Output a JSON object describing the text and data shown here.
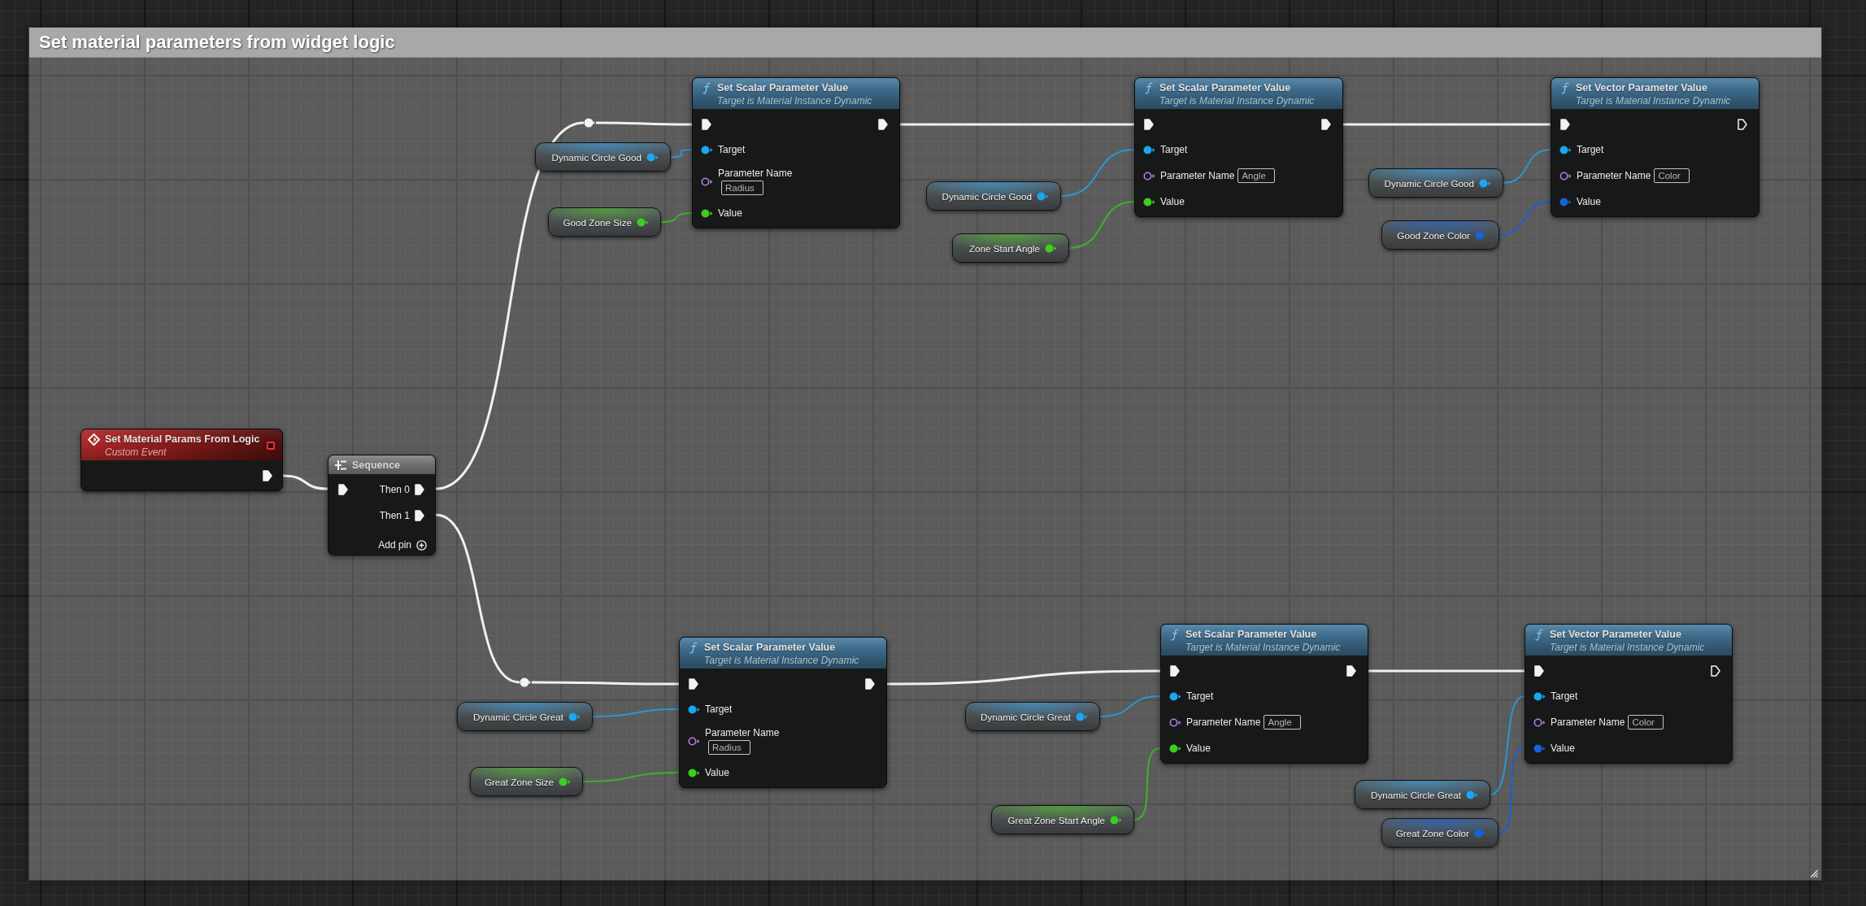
{
  "comment": {
    "title": "Set material parameters from widget logic"
  },
  "nodes": [
    {
      "kind": "event",
      "title": "Set Material Params From Logic",
      "subtitle": "Custom Event",
      "delegate": {
        "connected": false
      },
      "exec_out": {
        "connected": true
      }
    },
    {
      "kind": "sequence",
      "title": "Sequence",
      "exec_in": {
        "connected": true
      },
      "outputs": [
        {
          "label": "Then 0",
          "connected": true
        },
        {
          "label": "Then 1",
          "connected": true
        }
      ],
      "add_pin": "Add pin"
    },
    {
      "kind": "reroute"
    },
    {
      "kind": "variable",
      "name": "Dynamic Circle Good",
      "pin": {
        "kind": "object",
        "connected": true
      }
    },
    {
      "kind": "variable",
      "name": "Good Zone Size",
      "pin": {
        "kind": "float",
        "connected": true
      }
    },
    {
      "kind": "function",
      "title": "Set Scalar Parameter Value",
      "subtitle": "Target is Material Instance Dynamic",
      "exec_in": {
        "connected": true
      },
      "exec_out": {
        "connected": true
      },
      "inputs": [
        {
          "kind": "object",
          "label": "Target",
          "connected": true
        },
        {
          "kind": "name",
          "label": "Parameter Name",
          "value": "Radius",
          "connected": false
        },
        {
          "kind": "float",
          "label": "Value",
          "connected": true
        }
      ]
    },
    {
      "kind": "variable",
      "name": "Dynamic Circle Good",
      "pin": {
        "kind": "object",
        "connected": true
      }
    },
    {
      "kind": "variable",
      "name": "Zone Start Angle",
      "pin": {
        "kind": "float",
        "connected": true
      }
    },
    {
      "kind": "function",
      "title": "Set Scalar Parameter Value",
      "subtitle": "Target is Material Instance Dynamic",
      "exec_in": {
        "connected": true
      },
      "exec_out": {
        "connected": true
      },
      "inputs": [
        {
          "kind": "object",
          "label": "Target",
          "connected": true
        },
        {
          "kind": "name",
          "label": "Parameter Name",
          "value": "Angle",
          "connected": false
        },
        {
          "kind": "float",
          "label": "Value",
          "connected": true
        }
      ]
    },
    {
      "kind": "variable",
      "name": "Dynamic Circle Good",
      "pin": {
        "kind": "object",
        "connected": true
      }
    },
    {
      "kind": "variable",
      "name": "Good Zone Color",
      "pin": {
        "kind": "color",
        "connected": true
      }
    },
    {
      "kind": "function",
      "title": "Set Vector Parameter Value",
      "subtitle": "Target is Material Instance Dynamic",
      "exec_in": {
        "connected": true
      },
      "exec_out": {
        "connected": false
      },
      "inputs": [
        {
          "kind": "object",
          "label": "Target",
          "connected": true
        },
        {
          "kind": "name",
          "label": "Parameter Name",
          "value": "Color",
          "connected": false
        },
        {
          "kind": "color",
          "label": "Value",
          "connected": true
        }
      ]
    },
    {
      "kind": "reroute"
    },
    {
      "kind": "variable",
      "name": "Dynamic Circle Great",
      "pin": {
        "kind": "object",
        "connected": true
      }
    },
    {
      "kind": "variable",
      "name": "Great Zone Size",
      "pin": {
        "kind": "float",
        "connected": true
      }
    },
    {
      "kind": "function",
      "title": "Set Scalar Parameter Value",
      "subtitle": "Target is Material Instance Dynamic",
      "exec_in": {
        "connected": true
      },
      "exec_out": {
        "connected": true
      },
      "inputs": [
        {
          "kind": "object",
          "label": "Target",
          "connected": true
        },
        {
          "kind": "name",
          "label": "Parameter Name",
          "value": "Radius",
          "connected": false
        },
        {
          "kind": "float",
          "label": "Value",
          "connected": true
        }
      ]
    },
    {
      "kind": "variable",
      "name": "Dynamic Circle Great",
      "pin": {
        "kind": "object",
        "connected": true
      }
    },
    {
      "kind": "variable",
      "name": "Great Zone Start Angle",
      "pin": {
        "kind": "float",
        "connected": true
      }
    },
    {
      "kind": "function",
      "title": "Set Scalar Parameter Value",
      "subtitle": "Target is Material Instance Dynamic",
      "exec_in": {
        "connected": true
      },
      "exec_out": {
        "connected": true
      },
      "inputs": [
        {
          "kind": "object",
          "label": "Target",
          "connected": true
        },
        {
          "kind": "name",
          "label": "Parameter Name",
          "value": "Angle",
          "connected": false
        },
        {
          "kind": "float",
          "label": "Value",
          "connected": true
        }
      ]
    },
    {
      "kind": "variable",
      "name": "Dynamic Circle Great",
      "pin": {
        "kind": "object",
        "connected": true
      }
    },
    {
      "kind": "variable",
      "name": "Great Zone Color",
      "pin": {
        "kind": "color",
        "connected": true
      }
    },
    {
      "kind": "function",
      "title": "Set Vector Parameter Value",
      "subtitle": "Target is Material Instance Dynamic",
      "exec_in": {
        "connected": true
      },
      "exec_out": {
        "connected": false
      },
      "inputs": [
        {
          "kind": "object",
          "label": "Target",
          "connected": true
        },
        {
          "kind": "name",
          "label": "Parameter Name",
          "value": "Color",
          "connected": false
        },
        {
          "kind": "color",
          "label": "Value",
          "connected": true
        }
      ]
    }
  ]
}
